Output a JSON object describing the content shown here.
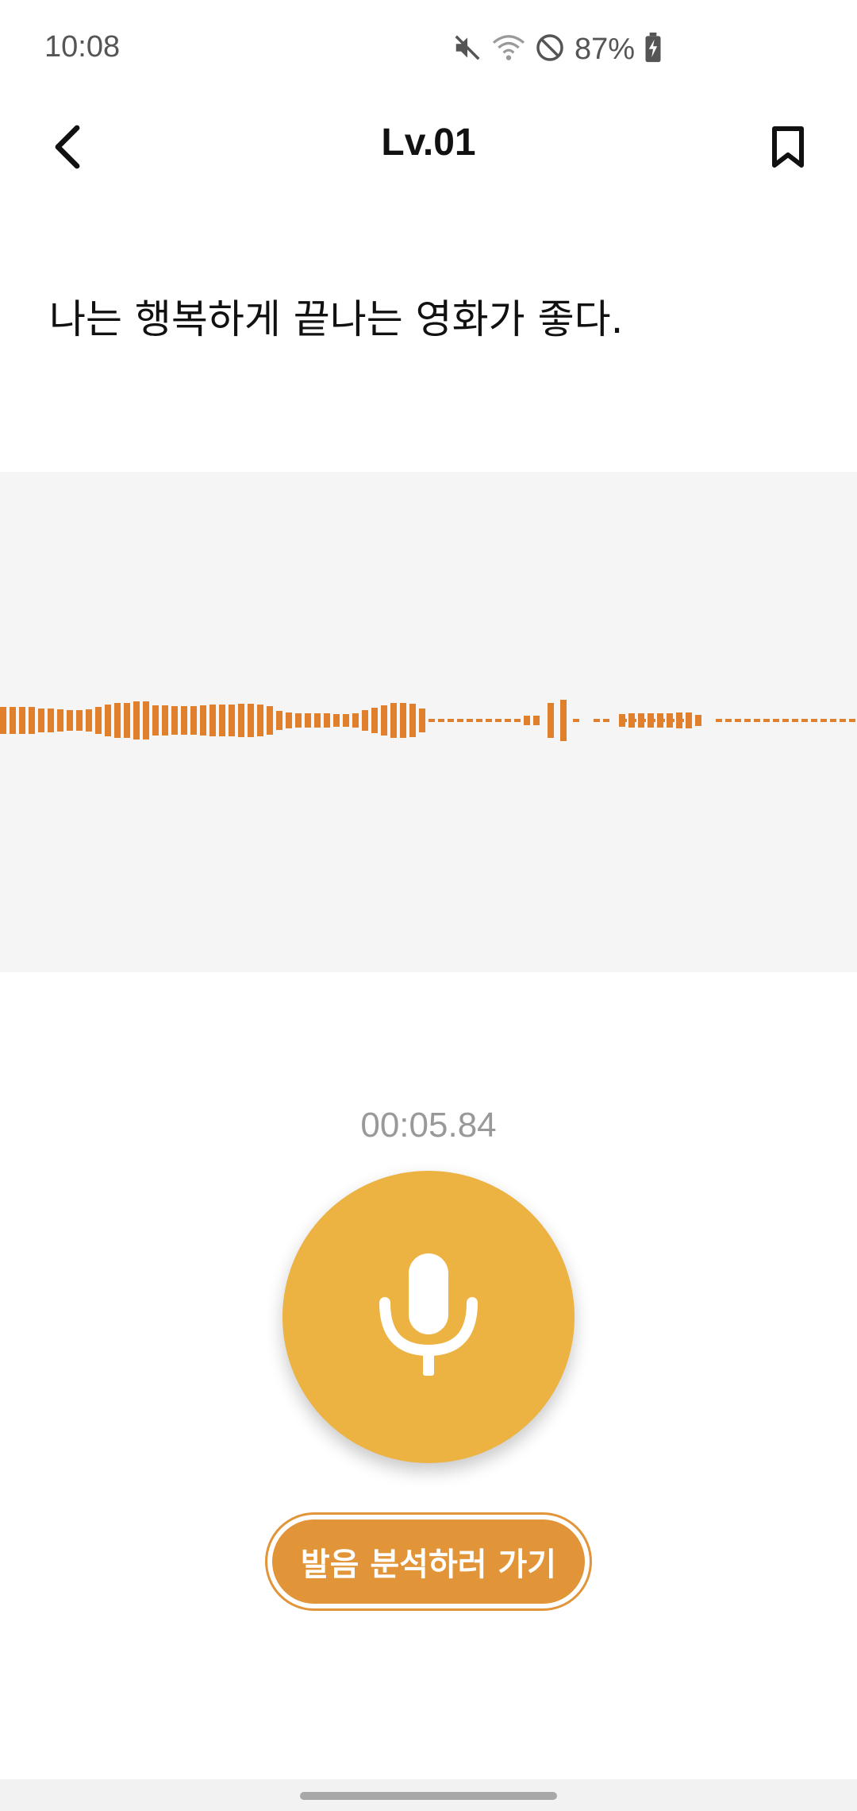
{
  "status_bar": {
    "time": "10:08",
    "battery_percent": "87%",
    "icons": [
      "mute-icon",
      "wifi-icon",
      "do-not-disturb-icon",
      "battery-charging-icon"
    ]
  },
  "header": {
    "title": "Lv.01",
    "back_icon": "chevron-left-icon",
    "bookmark_icon": "bookmark-icon"
  },
  "sentence": "나는 행복하게 끝나는 영화가 좋다.",
  "recording": {
    "elapsed": "00:05.84",
    "mic_icon": "microphone-icon"
  },
  "analyze_button_label": "발음 분석하러 가기",
  "colors": {
    "accent": "#ecb242",
    "accent_dark": "#e29438",
    "waveform": "#e07f2c",
    "panel_bg": "#f5f5f5"
  }
}
